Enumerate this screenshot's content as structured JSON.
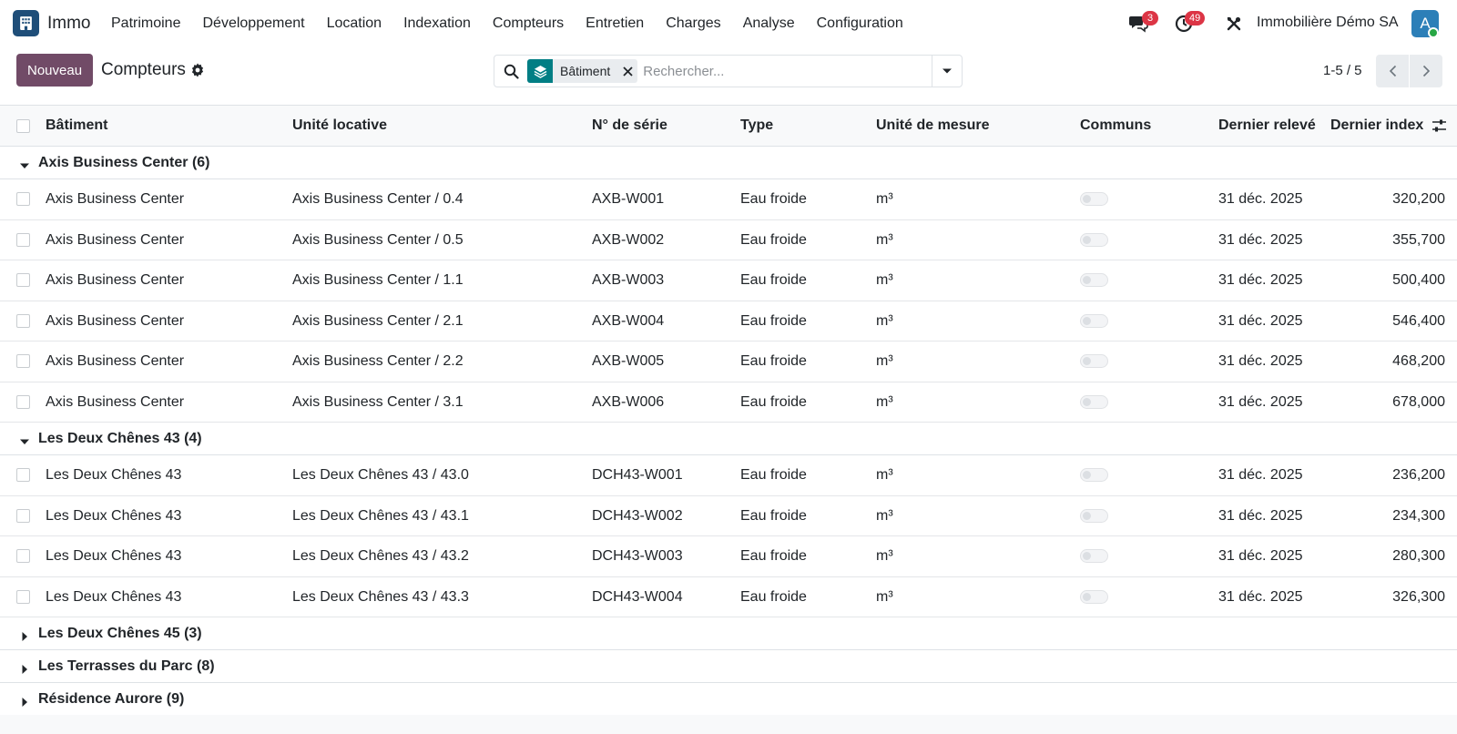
{
  "navbar": {
    "app_name": "Immo",
    "menu": [
      "Patrimoine",
      "Développement",
      "Location",
      "Indexation",
      "Compteurs",
      "Entretien",
      "Charges",
      "Analyse",
      "Configuration"
    ],
    "messages_badge": "3",
    "activities_badge": "49",
    "company": "Immobilière Démo SA",
    "avatar_letter": "A"
  },
  "control": {
    "new_button": "Nouveau",
    "title": "Compteurs",
    "facet_label": "Bâtiment",
    "search_placeholder": "Rechercher...",
    "pager": "1-5 / 5"
  },
  "table": {
    "columns": [
      "Bâtiment",
      "Unité locative",
      "N° de série",
      "Type",
      "Unité de mesure",
      "Communs",
      "Dernier relevé",
      "Dernier index"
    ],
    "groups": [
      {
        "label": "Axis Business Center (6)",
        "expanded": true,
        "rows": [
          [
            "Axis Business Center",
            "Axis Business Center / 0.4",
            "AXB-W001",
            "Eau froide",
            "m³",
            "31 déc. 2025",
            "320,200"
          ],
          [
            "Axis Business Center",
            "Axis Business Center / 0.5",
            "AXB-W002",
            "Eau froide",
            "m³",
            "31 déc. 2025",
            "355,700"
          ],
          [
            "Axis Business Center",
            "Axis Business Center / 1.1",
            "AXB-W003",
            "Eau froide",
            "m³",
            "31 déc. 2025",
            "500,400"
          ],
          [
            "Axis Business Center",
            "Axis Business Center / 2.1",
            "AXB-W004",
            "Eau froide",
            "m³",
            "31 déc. 2025",
            "546,400"
          ],
          [
            "Axis Business Center",
            "Axis Business Center / 2.2",
            "AXB-W005",
            "Eau froide",
            "m³",
            "31 déc. 2025",
            "468,200"
          ],
          [
            "Axis Business Center",
            "Axis Business Center / 3.1",
            "AXB-W006",
            "Eau froide",
            "m³",
            "31 déc. 2025",
            "678,000"
          ]
        ]
      },
      {
        "label": "Les Deux Chênes 43 (4)",
        "expanded": true,
        "rows": [
          [
            "Les Deux Chênes 43",
            "Les Deux Chênes 43 / 43.0",
            "DCH43-W001",
            "Eau froide",
            "m³",
            "31 déc. 2025",
            "236,200"
          ],
          [
            "Les Deux Chênes 43",
            "Les Deux Chênes 43 / 43.1",
            "DCH43-W002",
            "Eau froide",
            "m³",
            "31 déc. 2025",
            "234,300"
          ],
          [
            "Les Deux Chênes 43",
            "Les Deux Chênes 43 / 43.2",
            "DCH43-W003",
            "Eau froide",
            "m³",
            "31 déc. 2025",
            "280,300"
          ],
          [
            "Les Deux Chênes 43",
            "Les Deux Chênes 43 / 43.3",
            "DCH43-W004",
            "Eau froide",
            "m³",
            "31 déc. 2025",
            "326,300"
          ]
        ]
      },
      {
        "label": "Les Deux Chênes 45 (3)",
        "expanded": false,
        "rows": []
      },
      {
        "label": "Les Terrasses du Parc (8)",
        "expanded": false,
        "rows": []
      },
      {
        "label": "Résidence Aurore (9)",
        "expanded": false,
        "rows": []
      }
    ]
  },
  "colors": {
    "brand": "#714b67",
    "facet": "#017e84",
    "badge": "#dc3545"
  }
}
